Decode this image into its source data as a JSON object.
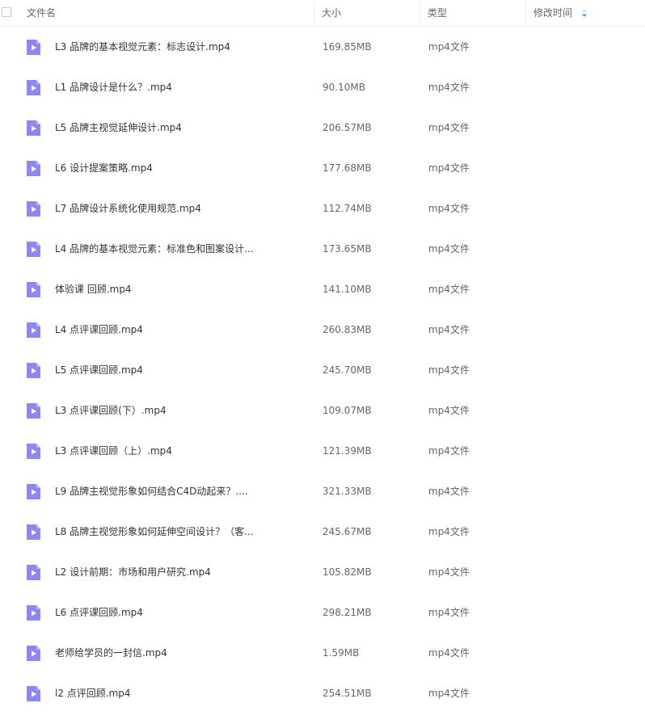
{
  "header": {
    "name_label": "文件名",
    "size_label": "大小",
    "type_label": "类型",
    "time_label": "修改时间"
  },
  "colors": {
    "icon": "#8e86f5",
    "sort": "#3aa0e9"
  },
  "files": [
    {
      "name": "L3 品牌的基本视觉元素：标志设计.mp4",
      "size": "169.85MB",
      "type": "mp4文件"
    },
    {
      "name": "L1 品牌设计是什么？.mp4",
      "size": "90.10MB",
      "type": "mp4文件"
    },
    {
      "name": "L5 品牌主视觉延伸设计.mp4",
      "size": "206.57MB",
      "type": "mp4文件"
    },
    {
      "name": "L6 设计提案策略.mp4",
      "size": "177.68MB",
      "type": "mp4文件"
    },
    {
      "name": "L7 品牌设计系统化使用规范.mp4",
      "size": "112.74MB",
      "type": "mp4文件"
    },
    {
      "name": "L4 品牌的基本视觉元素：标准色和图案设计...",
      "size": "173.65MB",
      "type": "mp4文件"
    },
    {
      "name": "体验课 回顾.mp4",
      "size": "141.10MB",
      "type": "mp4文件"
    },
    {
      "name": "L4 点评课回顾.mp4",
      "size": "260.83MB",
      "type": "mp4文件"
    },
    {
      "name": "L5 点评课回顾.mp4",
      "size": "245.70MB",
      "type": "mp4文件"
    },
    {
      "name": "L3 点评课回顾(下）.mp4",
      "size": "109.07MB",
      "type": "mp4文件"
    },
    {
      "name": "L3 点评课回顾（上）.mp4",
      "size": "121.39MB",
      "type": "mp4文件"
    },
    {
      "name": "L9 品牌主视觉形象如何结合C4D动起来？....",
      "size": "321.33MB",
      "type": "mp4文件"
    },
    {
      "name": "L8 品牌主视觉形象如何延伸空间设计？（客...",
      "size": "245.67MB",
      "type": "mp4文件"
    },
    {
      "name": "L2 设计前期：市场和用户研究.mp4",
      "size": "105.82MB",
      "type": "mp4文件"
    },
    {
      "name": "L6 点评课回顾.mp4",
      "size": "298.21MB",
      "type": "mp4文件"
    },
    {
      "name": "老师给学员的一封信.mp4",
      "size": "1.59MB",
      "type": "mp4文件"
    },
    {
      "name": "l2 点评回顾.mp4",
      "size": "254.51MB",
      "type": "mp4文件"
    }
  ]
}
